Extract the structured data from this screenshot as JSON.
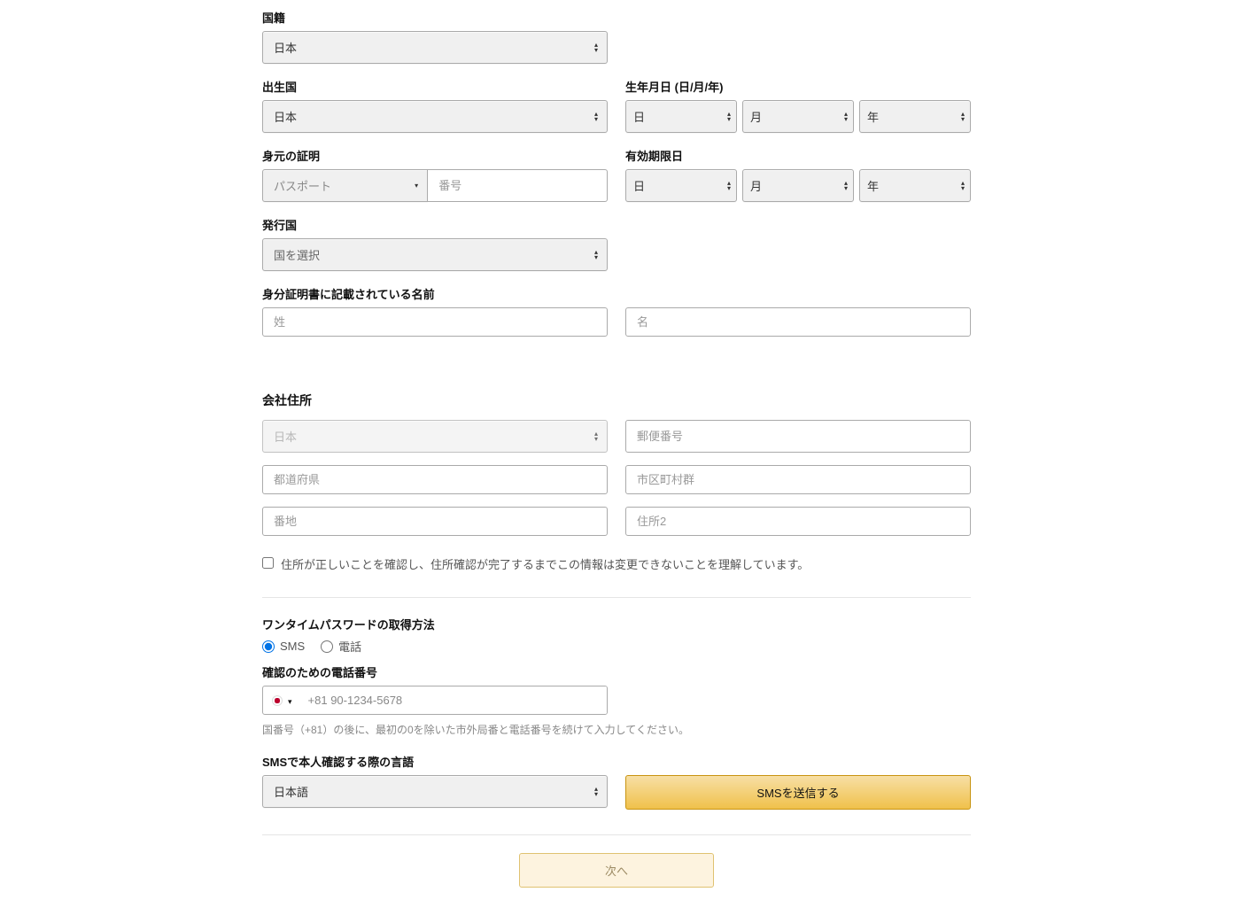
{
  "labels": {
    "nationality": "国籍",
    "birth_country": "出生国",
    "dob": "生年月日 (日/月/年)",
    "id_proof": "身元の証明",
    "expiry": "有効期限日",
    "issuing_country": "発行国",
    "id_name": "身分証明書に記載されている名前",
    "company_address": "会社住所",
    "otp_method": "ワンタイムパスワードの取得方法",
    "verify_phone": "確認のための電話番号",
    "sms_language": "SMSで本人確認する際の言語"
  },
  "values": {
    "nationality": "日本",
    "birth_country": "日本",
    "id_type": "パスポート",
    "issuing_country": "国を選択",
    "address_country": "日本",
    "sms_language": "日本語"
  },
  "placeholders": {
    "id_number": "番号",
    "last_name": "姓",
    "first_name": "名",
    "postal_code": "郵便番号",
    "prefecture": "都道府県",
    "city": "市区町村群",
    "street": "番地",
    "address2": "住所2",
    "phone": "+81 90-1234-5678",
    "day": "日",
    "month": "月",
    "year": "年"
  },
  "options": {
    "otp_sms": "SMS",
    "otp_phone": "電話"
  },
  "text": {
    "confirm_address": "住所が正しいことを確認し、住所確認が完了するまでこの情報は変更できないことを理解しています。",
    "phone_help": "国番号（+81）の後に、最初の0を除いた市外局番と電話番号を続けて入力してください。"
  },
  "buttons": {
    "send_sms": "SMSを送信する",
    "next": "次へ"
  }
}
